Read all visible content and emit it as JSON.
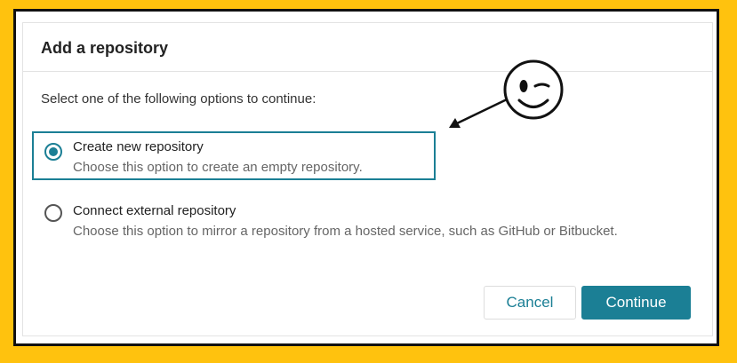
{
  "dialog": {
    "title": "Add a repository",
    "instruction": "Select one of the following options to continue:"
  },
  "options": [
    {
      "label": "Create new repository",
      "description": "Choose this option to create an empty repository.",
      "selected": true
    },
    {
      "label": "Connect external repository",
      "description": "Choose this option to mirror a repository from a hosted service, such as GitHub or Bitbucket.",
      "selected": false
    }
  ],
  "buttons": {
    "cancel_label": "Cancel",
    "continue_label": "Continue"
  },
  "annotation": {
    "icon": "winking-face-icon"
  },
  "colors": {
    "accent": "#1b7f95",
    "border_yellow": "#FFC20E",
    "frame_border": "#111111"
  }
}
